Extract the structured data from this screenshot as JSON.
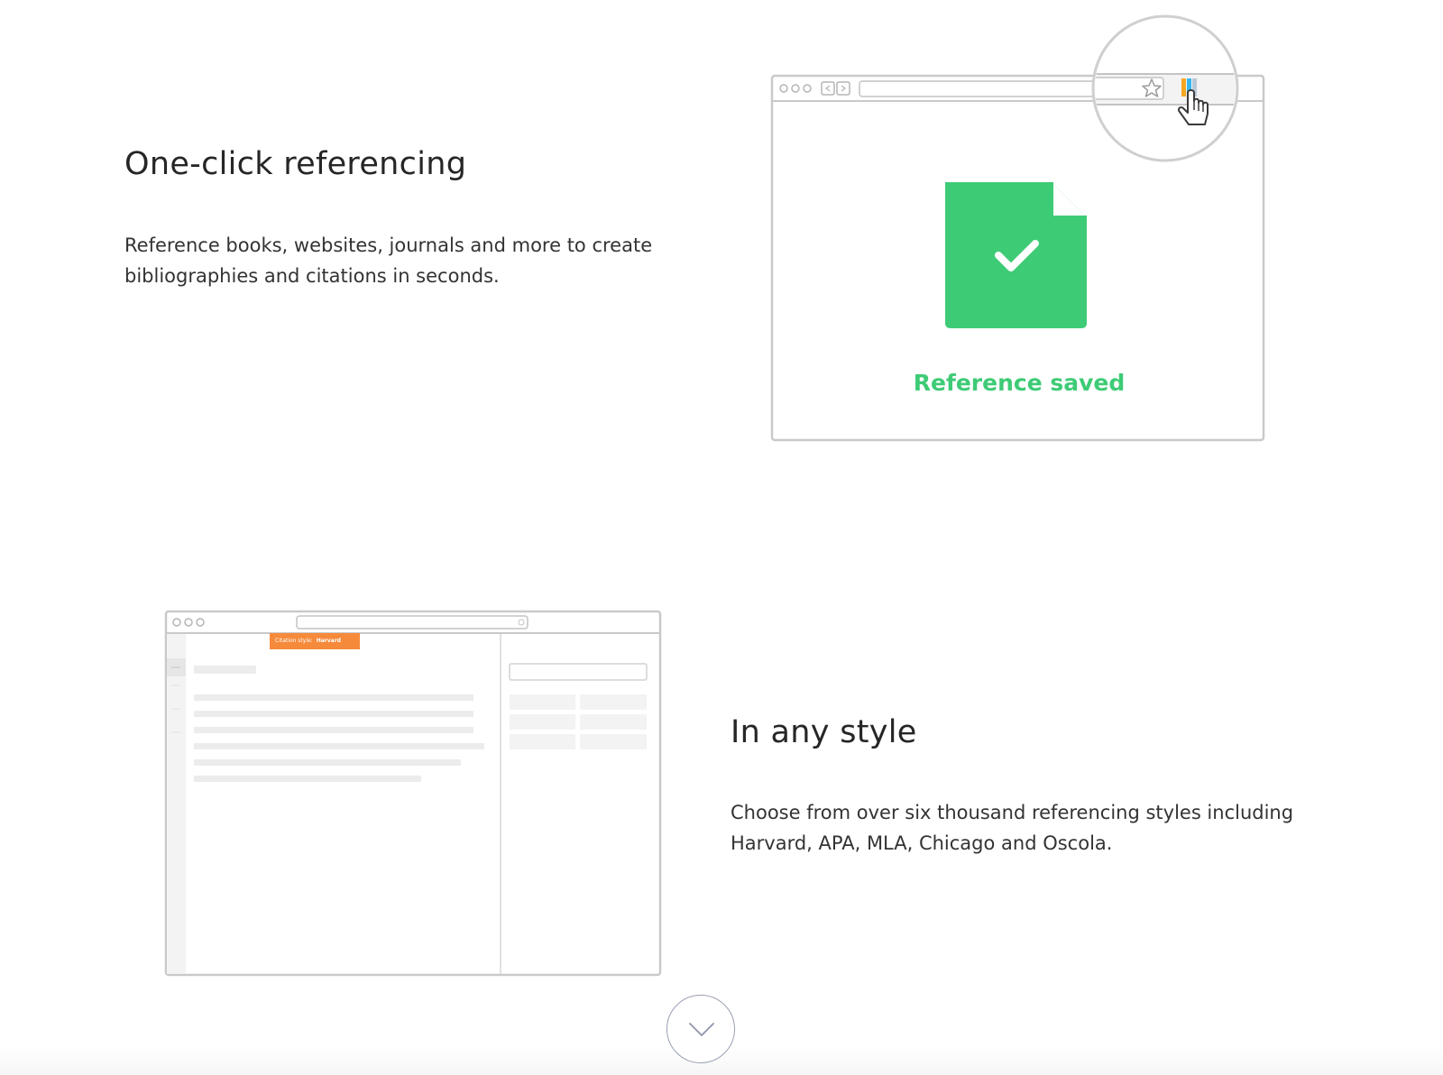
{
  "features": [
    {
      "title": "One-click referencing",
      "description": "Reference books, websites, journals and more to create bibliographies and citations in seconds.",
      "illustration": {
        "status_label": "Reference saved",
        "icons": [
          "browser-window-icon",
          "star-icon",
          "extension-bars-icon",
          "hand-pointer-icon",
          "document-check-icon"
        ]
      }
    },
    {
      "title": "In any style",
      "description": "Choose from over six thousand referencing styles including Harvard, APA, MLA, Chicago and Oscola.",
      "illustration": {
        "citation_style_label": "Citation style:",
        "citation_style_value": "Harvard",
        "icons": [
          "browser-window-icon"
        ]
      }
    }
  ],
  "scroll_button": {
    "icon": "chevron-down-icon"
  },
  "colors": {
    "success_green": "#3ecb76",
    "accent_orange": "#f68a3b",
    "extension_orange": "#f5a623",
    "extension_blue": "#35b6ee",
    "extension_grey": "#b8c7d6",
    "outline_grey": "#c8c8c8"
  }
}
